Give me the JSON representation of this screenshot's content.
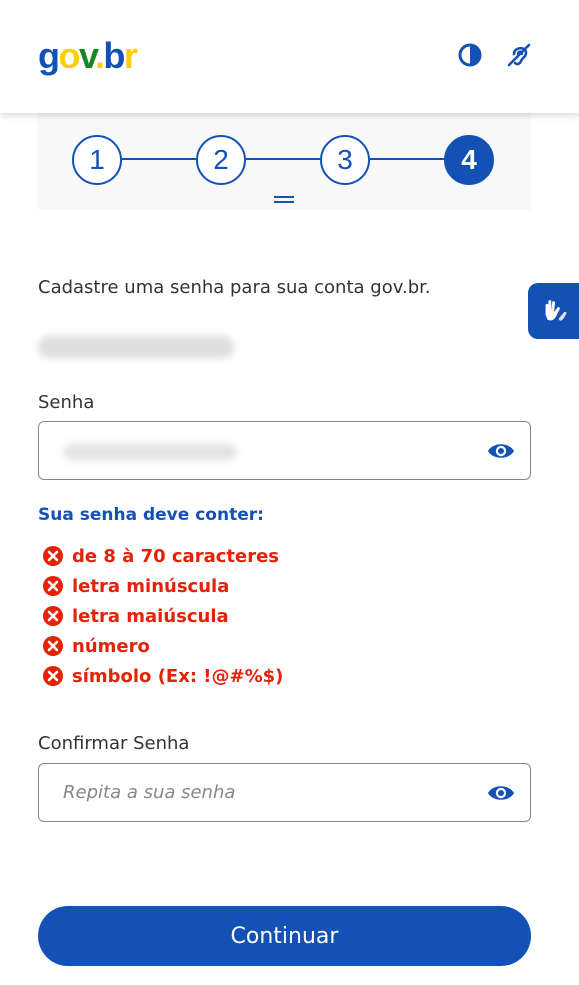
{
  "header": {
    "logo_parts": [
      "g",
      "o",
      "v",
      ".",
      "b",
      "r"
    ],
    "contrast_icon": "contrast-icon",
    "accessibility_icon": "hearing-impaired-icon"
  },
  "stepper": {
    "steps": [
      "1",
      "2",
      "3",
      "4"
    ],
    "active_step": 4
  },
  "intro": "Cadastre uma senha para sua conta gov.br.",
  "password": {
    "label": "Senha",
    "icon": "eye-icon"
  },
  "requirements": {
    "title": "Sua senha deve conter:",
    "items": [
      "de 8 à 70 caracteres",
      "letra minúscula",
      "letra maiúscula",
      "número",
      "símbolo (Ex: !@#%$)"
    ]
  },
  "confirm": {
    "label": "Confirmar Senha",
    "placeholder": "Repita a sua senha",
    "icon": "eye-icon"
  },
  "continue_label": "Continuar",
  "colors": {
    "primary": "#1351b4",
    "error": "#e52207",
    "logo_blue": "#1351b4",
    "logo_yellow": "#ffcd07",
    "logo_green": "#168821"
  }
}
